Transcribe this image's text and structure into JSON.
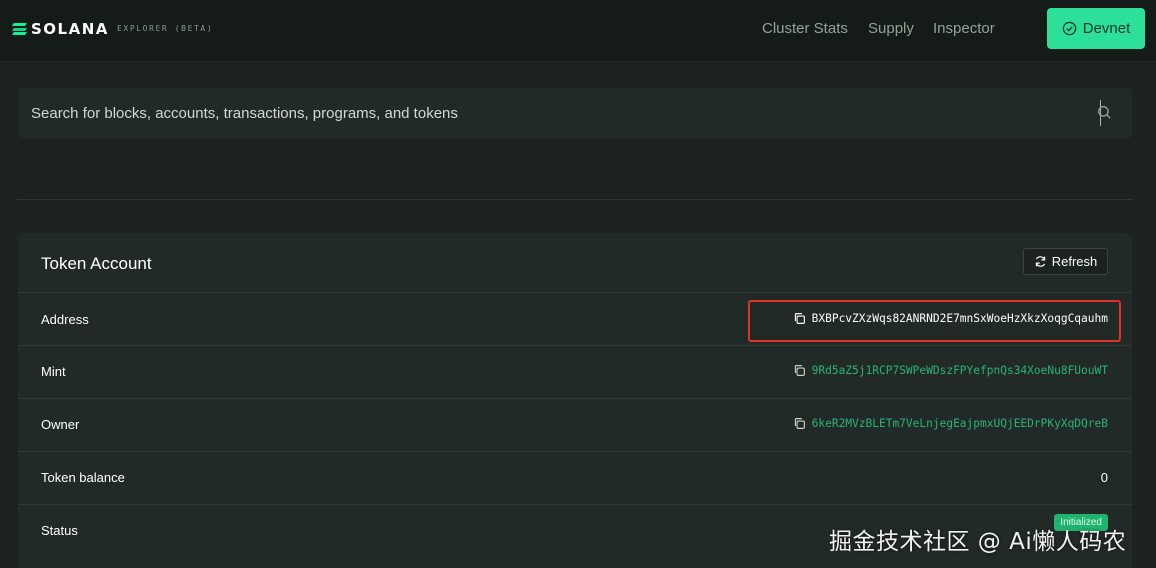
{
  "brand": {
    "logo_text": "SOLANA",
    "sub": "EXPLORER (BETA)"
  },
  "nav": {
    "cluster_stats": "Cluster Stats",
    "supply": "Supply",
    "inspector": "Inspector",
    "network": "Devnet"
  },
  "search": {
    "placeholder": "Search for blocks, accounts, transactions, programs, and tokens",
    "value": ""
  },
  "card": {
    "title": "Token Account",
    "refresh_label": "Refresh",
    "rows": [
      {
        "label": "Address",
        "value": "BXBPcvZXzWqs82ANRND2E7mnSxWoeHzXkzXoqgCqauhm"
      },
      {
        "label": "Mint",
        "value": "9Rd5aZ5j1RCP7SWPeWDszFPYefpnQs34XoeNu8FUouWT"
      },
      {
        "label": "Owner",
        "value": "6keR2MVzBLETm7VeLnjegEajpmxUQjEEDrPKyXqDQreB"
      },
      {
        "label": "Token balance",
        "value": "0"
      },
      {
        "label": "Status",
        "value": "Initialized"
      }
    ]
  },
  "watermark": "掘金技术社区 @ Ai懒人码农",
  "colors": {
    "accent": "#2ce09a",
    "link": "#28b27a",
    "highlight": "#e0302a",
    "background": "#1b2220"
  }
}
